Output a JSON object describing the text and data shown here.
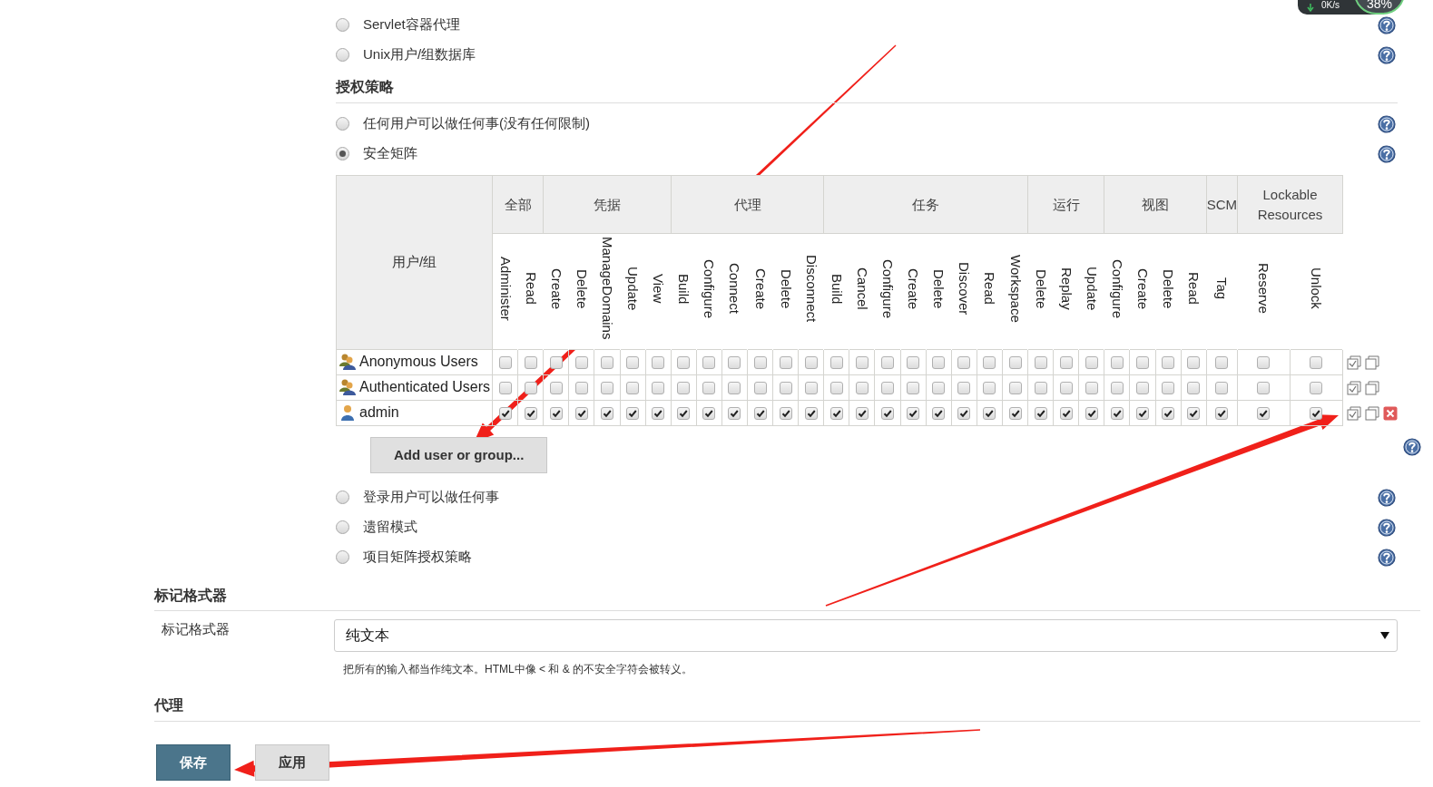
{
  "net_widget": {
    "speed": "0K/s",
    "percent": "38%"
  },
  "security_realm": {
    "options": [
      {
        "label": "Servlet容器代理",
        "selected": false
      },
      {
        "label": "Unix用户/组数据库",
        "selected": false
      }
    ]
  },
  "authorization": {
    "heading": "授权策略",
    "options": [
      {
        "label": "任何用户可以做任何事(没有任何限制)",
        "selected": false
      },
      {
        "label": "安全矩阵",
        "selected": true,
        "matrix": {
          "user_column": "用户/组",
          "groups": [
            {
              "label": "全部",
              "permissions": [
                "Administer",
                "Read"
              ]
            },
            {
              "label": "凭据",
              "permissions": [
                "Create",
                "Delete",
                "ManageDomains",
                "Update",
                "View"
              ]
            },
            {
              "label": "代理",
              "permissions": [
                "Build",
                "Configure",
                "Connect",
                "Create",
                "Delete",
                "Disconnect"
              ]
            },
            {
              "label": "任务",
              "permissions": [
                "Build",
                "Cancel",
                "Configure",
                "Create",
                "Delete",
                "Discover",
                "Read",
                "Workspace"
              ]
            },
            {
              "label": "运行",
              "permissions": [
                "Delete",
                "Replay",
                "Update"
              ]
            },
            {
              "label": "视图",
              "permissions": [
                "Configure",
                "Create",
                "Delete",
                "Read"
              ]
            },
            {
              "label": "SCM",
              "permissions": [
                "Tag"
              ]
            },
            {
              "label": "Lockable Resources",
              "permissions": [
                "Reserve",
                "Unlock"
              ],
              "wide": true
            }
          ],
          "rows": [
            {
              "name": "Anonymous Users",
              "kind": "group",
              "removable": false,
              "checks": [
                false,
                false,
                false,
                false,
                false,
                false,
                false,
                false,
                false,
                false,
                false,
                false,
                false,
                false,
                false,
                false,
                false,
                false,
                false,
                false,
                false,
                false,
                false,
                false,
                false,
                false,
                false,
                false,
                false,
                false,
                false
              ]
            },
            {
              "name": "Authenticated Users",
              "kind": "group",
              "removable": false,
              "checks": [
                false,
                false,
                false,
                false,
                false,
                false,
                false,
                false,
                false,
                false,
                false,
                false,
                false,
                false,
                false,
                false,
                false,
                false,
                false,
                false,
                false,
                false,
                false,
                false,
                false,
                false,
                false,
                false,
                false,
                false,
                false
              ]
            },
            {
              "name": "admin",
              "kind": "user",
              "removable": true,
              "checks": [
                true,
                true,
                true,
                true,
                true,
                true,
                true,
                true,
                true,
                true,
                true,
                true,
                true,
                true,
                true,
                true,
                true,
                true,
                true,
                true,
                true,
                true,
                true,
                true,
                true,
                true,
                true,
                true,
                true,
                true,
                true
              ]
            }
          ],
          "add_button": "Add user or group..."
        }
      },
      {
        "label": "登录用户可以做任何事",
        "selected": false
      },
      {
        "label": "遗留模式",
        "selected": false
      },
      {
        "label": "项目矩阵授权策略",
        "selected": false
      }
    ]
  },
  "markup_formatter": {
    "heading": "标记格式器",
    "label": "标记格式器",
    "value": "纯文本",
    "description": "把所有的输入都当作纯文本。HTML中像 < 和 & 的不安全字符会被转义。"
  },
  "proxy": {
    "heading": "代理"
  },
  "buttons": [
    {
      "label": "保存",
      "kind": "primary"
    },
    {
      "label": "应用",
      "kind": "secondary"
    }
  ]
}
